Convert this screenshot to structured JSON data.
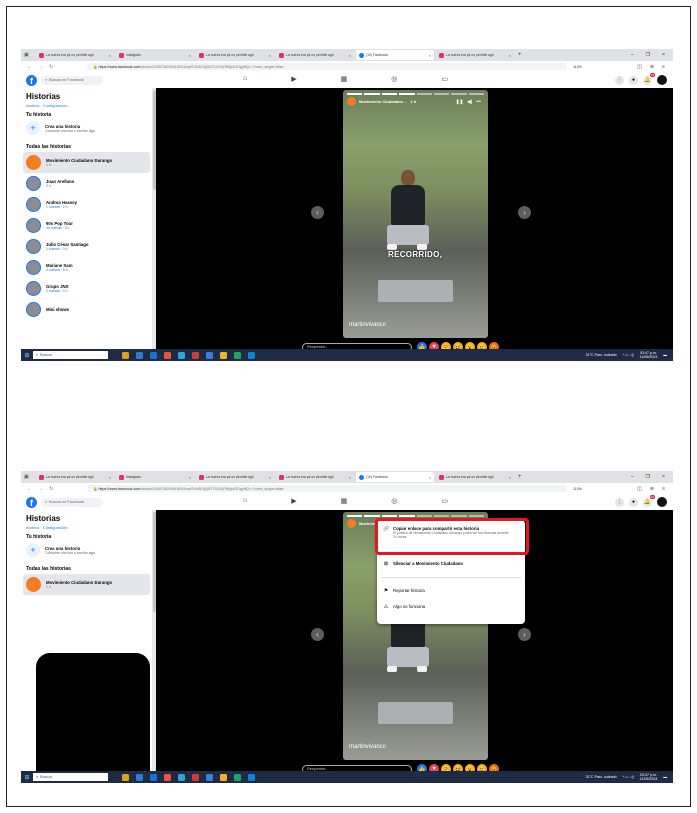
{
  "browser": {
    "tabs": [
      {
        "label": "La nueva era ya no permite agü"
      },
      {
        "label": "Instagram"
      },
      {
        "label": "La nueva era ya no permite agü"
      },
      {
        "label": "La nueva era ya no permite agü"
      },
      {
        "label": "(10) Facebook"
      },
      {
        "label": "La nueva era ya no permite agü"
      }
    ],
    "url_host": "https://www.facebook.com",
    "url_path": "/stories/104973620941693/UzpfSVNDOjQ5OTU2NjY5Mjc4ODgyNQ==?view_single=false",
    "zoom": "110%"
  },
  "fb": {
    "search_placeholder": "Buscar en Facebook",
    "notif_count": "10",
    "sidebar": {
      "title": "Historias",
      "links": "Archivo · Configuración",
      "tu_historia": "Tu historia",
      "create_title": "Crea una historia",
      "create_sub": "Comparte una foto o escribe algo.",
      "todas": "Todas las historias",
      "stories": [
        {
          "name": "Movimiento Ciudadano Durango",
          "meta": "1 h"
        },
        {
          "name": "Juan Arellano",
          "meta": "2 h"
        },
        {
          "name": "Andrea Hassey",
          "meta": "1 nuevas · 2 h"
        },
        {
          "name": "90s Pop Tour",
          "meta": "34 nuevas · 3 h"
        },
        {
          "name": "Julio César Santiago",
          "meta": "1 nuevas · 3 h"
        },
        {
          "name": "Mariane Sam",
          "meta": "4 nuevas · 5 h"
        },
        {
          "name": "Grupo JNS",
          "meta": "2 nuevas · 3 h"
        },
        {
          "name": "Mini shows",
          "meta": ""
        }
      ]
    },
    "story": {
      "author": "Movimiento Ciudadano ...",
      "time": "1 h",
      "overlay_text": "RECORRIDO,",
      "watermark": "martinvivanco",
      "reply_placeholder": "Responder..."
    },
    "menu": {
      "copy_title": "Copiar enlace para compartir esta historia",
      "copy_sub": "El público de Movimiento Ciudadano Durango podrá ver tus historias durante 24 horas.",
      "silence": "Silenciar a Movimiento Ciudadano",
      "report": "Reportar historia",
      "broken": "Algo no funciona"
    }
  },
  "taskbar": {
    "search": "Buscar",
    "weather": "31°C Parc. soleado",
    "time": "03:47 p.m.",
    "date": "11/06/2024"
  },
  "colors": {
    "fb_blue": "#1877f2",
    "highlight_red": "#e8161d",
    "mc_orange": "#f47d20"
  }
}
